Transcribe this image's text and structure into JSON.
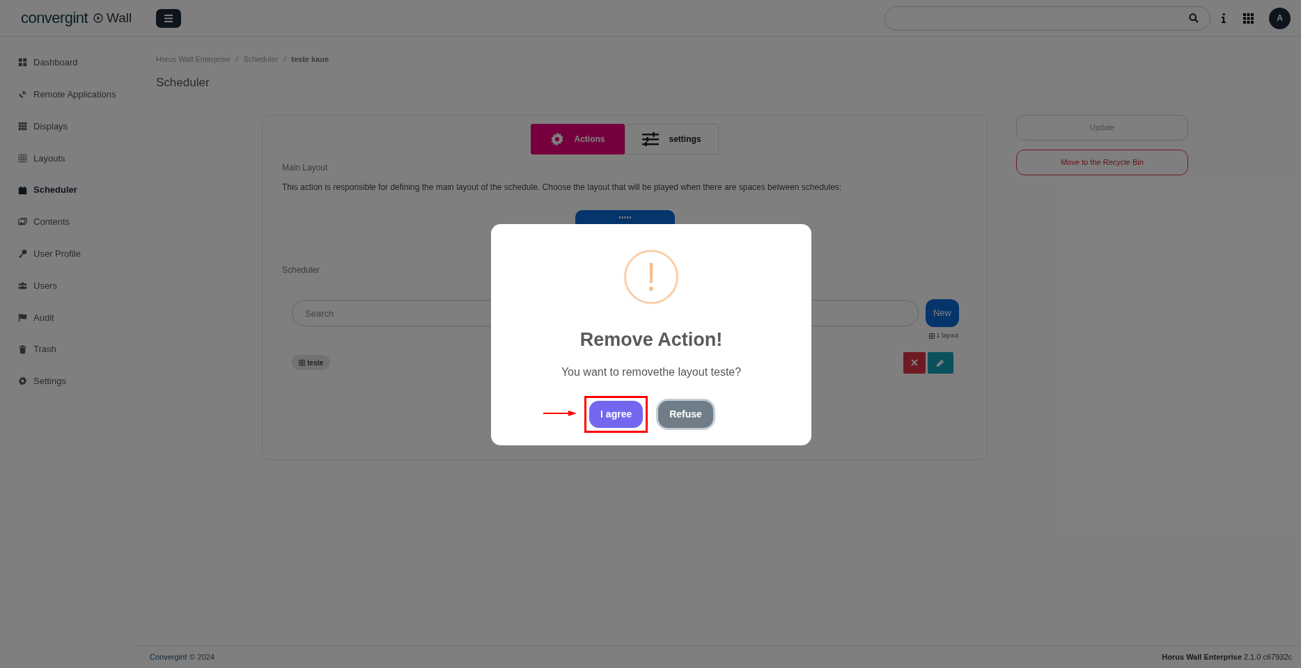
{
  "topbar": {
    "logo": "convergint",
    "product": "Wall",
    "avatar": "A"
  },
  "sidebar": {
    "items": [
      {
        "label": "Dashboard",
        "selected": false
      },
      {
        "label": "Remote Applications",
        "selected": false
      },
      {
        "label": "Displays",
        "selected": false
      },
      {
        "label": "Layouts",
        "selected": false
      },
      {
        "label": "Scheduler",
        "selected": true
      },
      {
        "label": "Contents",
        "selected": false
      },
      {
        "label": "User Profile",
        "selected": false
      },
      {
        "label": "Users",
        "selected": false
      },
      {
        "label": "Audit",
        "selected": false
      },
      {
        "label": "Trash",
        "selected": false
      },
      {
        "label": "Settings",
        "selected": false
      }
    ]
  },
  "breadcrumb": {
    "separator": "/",
    "items": [
      "Horus Wall Enterprise",
      "Scheduler",
      "teste kaue"
    ]
  },
  "page_title": "Scheduler",
  "tabs": [
    {
      "label": "Actions",
      "selected": true
    },
    {
      "label": "settings",
      "selected": false
    }
  ],
  "main_layout": {
    "label": "Main Layout",
    "description": "This action is responsible for defining the main layout of the schedule. Choose the layout that will be played when there are spaces between schedules:"
  },
  "scheduler": {
    "label": "Scheduler",
    "search": {
      "placeholder": "Search"
    },
    "new_button": "New",
    "count": "1 layout",
    "items": [
      {
        "label": "teste"
      }
    ]
  },
  "side_actions": [
    {
      "label": "Update",
      "kind": "neutral"
    },
    {
      "label": "Move to the Recycle Bin",
      "kind": "danger"
    }
  ],
  "modal": {
    "title": "Remove Action!",
    "message": "You want to removethe layout teste?",
    "buttons": [
      {
        "label": "I agree",
        "kind": "confirm",
        "highlighted": true
      },
      {
        "label": "Refuse",
        "kind": "cancel",
        "highlighted": false
      }
    ]
  },
  "footer": {
    "company": "Convergint",
    "copyright": "© 2024",
    "version": "**Horus Wall Enterprise** 2.1.0 c67932c"
  }
}
